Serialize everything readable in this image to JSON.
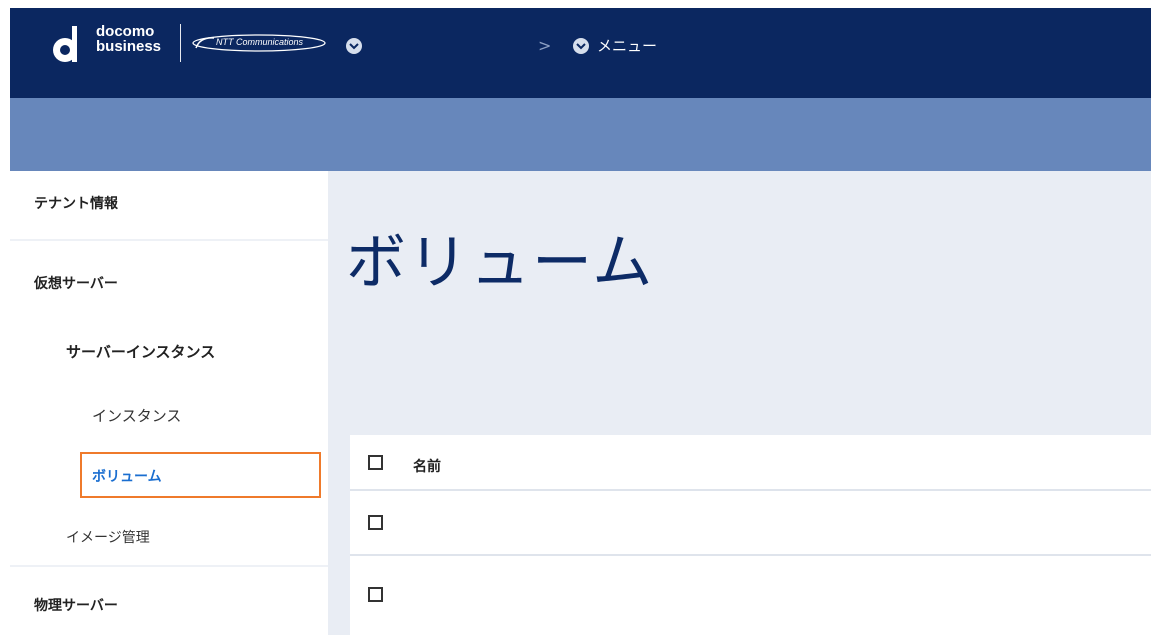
{
  "header": {
    "logo_line1": "docomo",
    "logo_line2": "business",
    "partner_logo": "NTT Communications",
    "breadcrumb_menu": "メニュー",
    "breadcrumb_separator": ">"
  },
  "sidebar": {
    "items": [
      {
        "label": "テナント情報"
      },
      {
        "label": "仮想サーバー"
      },
      {
        "label": "サーバーインスタンス"
      },
      {
        "label": "インスタンス"
      },
      {
        "label": "ボリューム",
        "selected": true
      },
      {
        "label": "イメージ管理"
      },
      {
        "label": "物理サーバー"
      }
    ]
  },
  "main": {
    "page_title": "ボリューム",
    "table": {
      "columns": [
        "名前"
      ],
      "rows": [
        {},
        {}
      ]
    }
  },
  "colors": {
    "topbar": "#0b2760",
    "subbar": "#6787bb",
    "main_bg": "#e9edf4",
    "accent": "#1a6ed0",
    "highlight": "#ef7a2b"
  },
  "icons": [
    "docomo-d-logo",
    "ntt-communications-logo",
    "chevron-down-circle-icon",
    "breadcrumb-arrow-icon",
    "checkbox-icon"
  ]
}
